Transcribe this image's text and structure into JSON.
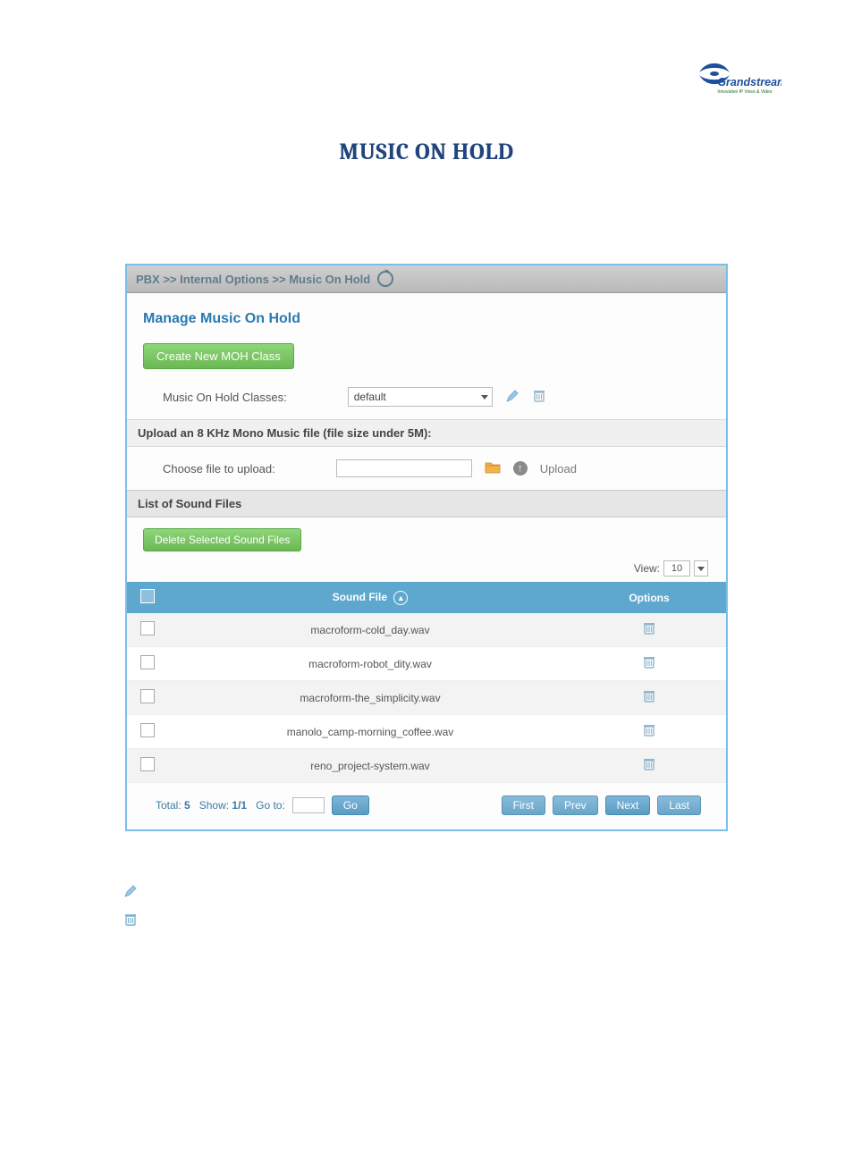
{
  "doc": {
    "title": "MUSIC ON HOLD",
    "logo_brand": "Grandstream",
    "logo_tagline": "Innovative IP Voice & Video"
  },
  "panel": {
    "breadcrumb": "PBX >> Internal Options >> Music On Hold",
    "heading": "Manage Music On Hold",
    "create_btn": "Create New MOH Class",
    "classes_label": "Music On Hold Classes:",
    "classes_selected": "default",
    "upload_heading": "Upload an 8 KHz Mono Music file (file size under 5M):",
    "choose_label": "Choose file to upload:",
    "upload_label": "Upload",
    "list_heading": "List of Sound Files",
    "delete_selected_btn": "Delete Selected Sound Files",
    "view_label": "View:",
    "view_value": "10",
    "columns": {
      "sound_file": "Sound File",
      "options": "Options"
    },
    "rows": [
      {
        "file": "macroform-cold_day.wav"
      },
      {
        "file": "macroform-robot_dity.wav"
      },
      {
        "file": "macroform-the_simplicity.wav"
      },
      {
        "file": "manolo_camp-morning_coffee.wav"
      },
      {
        "file": "reno_project-system.wav"
      }
    ],
    "pager": {
      "total_label": "Total:",
      "total_value": "5",
      "show_label": "Show:",
      "show_value": "1/1",
      "goto_label": "Go to:",
      "go_btn": "Go",
      "first": "First",
      "prev": "Prev",
      "next": "Next",
      "last": "Last"
    }
  }
}
